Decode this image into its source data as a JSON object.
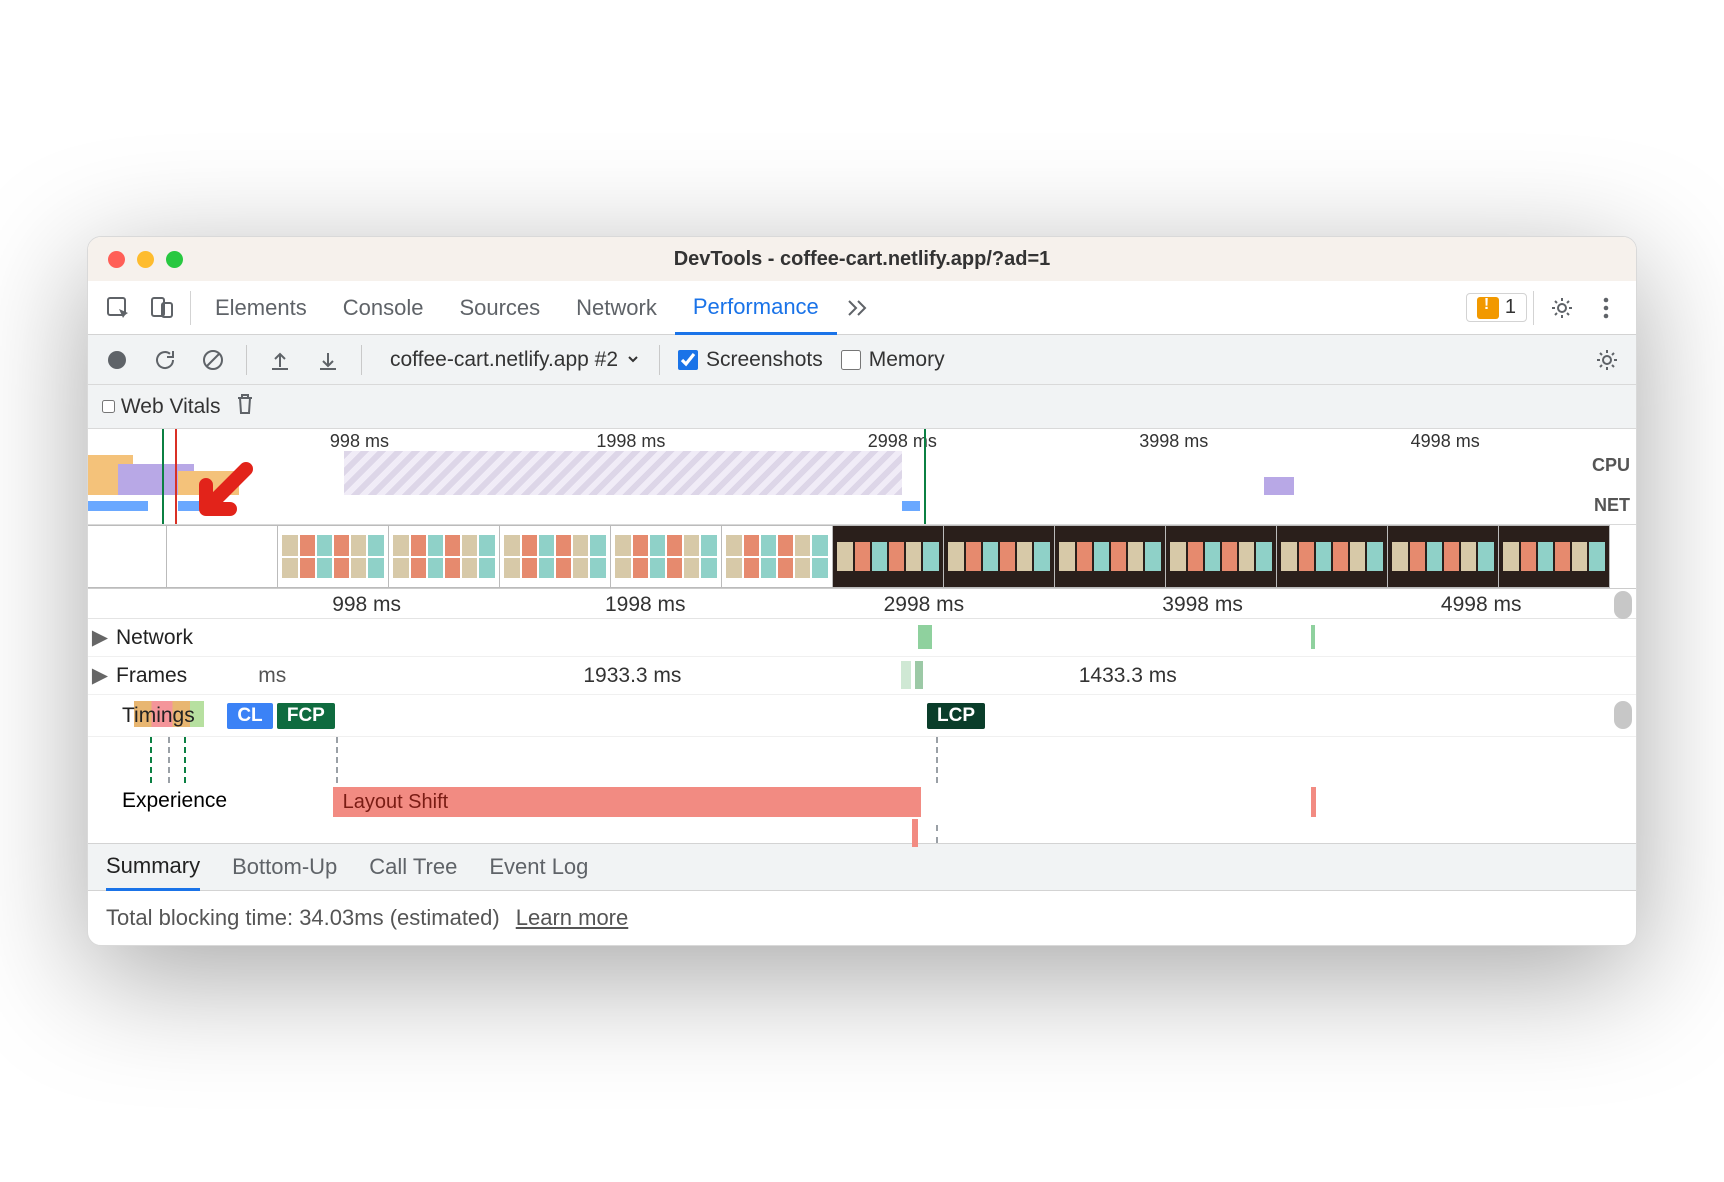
{
  "window": {
    "title": "DevTools - coffee-cart.netlify.app/?ad=1"
  },
  "tabs": {
    "items": [
      "Elements",
      "Console",
      "Sources",
      "Network",
      "Performance"
    ],
    "active": "Performance",
    "overflow_icon": "chevrons-right",
    "issues_count": "1"
  },
  "toolbar": {
    "recording_dropdown": "coffee-cart.netlify.app #2",
    "screenshots_label": "Screenshots",
    "screenshots_checked": true,
    "memory_label": "Memory",
    "memory_checked": false
  },
  "subtoolbar": {
    "web_vitals_label": "Web Vitals",
    "web_vitals_checked": false
  },
  "overview": {
    "ticks": [
      {
        "label": "998 ms",
        "pct": 18
      },
      {
        "label": "1998 ms",
        "pct": 36
      },
      {
        "label": "2998 ms",
        "pct": 54
      },
      {
        "label": "3998 ms",
        "pct": 72
      },
      {
        "label": "4998 ms",
        "pct": 90
      }
    ],
    "cpu_label": "CPU",
    "net_label": "NET"
  },
  "flame": {
    "ticks": [
      {
        "label": "998 ms",
        "pct": 18
      },
      {
        "label": "1998 ms",
        "pct": 36
      },
      {
        "label": "2998 ms",
        "pct": 54
      },
      {
        "label": "3998 ms",
        "pct": 72
      },
      {
        "label": "4998 ms",
        "pct": 90
      }
    ],
    "tracks": {
      "network": "Network",
      "frames": "Frames",
      "frames_values": [
        "ms",
        "1933.3 ms",
        "1433.3 ms"
      ],
      "timings": "Timings",
      "cls": "CL",
      "fcp": "FCP",
      "lcp": "LCP",
      "experience": "Experience",
      "layout_shift": "Layout Shift"
    }
  },
  "bottom_tabs": {
    "items": [
      "Summary",
      "Bottom-Up",
      "Call Tree",
      "Event Log"
    ],
    "active": "Summary"
  },
  "status": {
    "text": "Total blocking time: 34.03ms (estimated)",
    "link": "Learn more"
  }
}
